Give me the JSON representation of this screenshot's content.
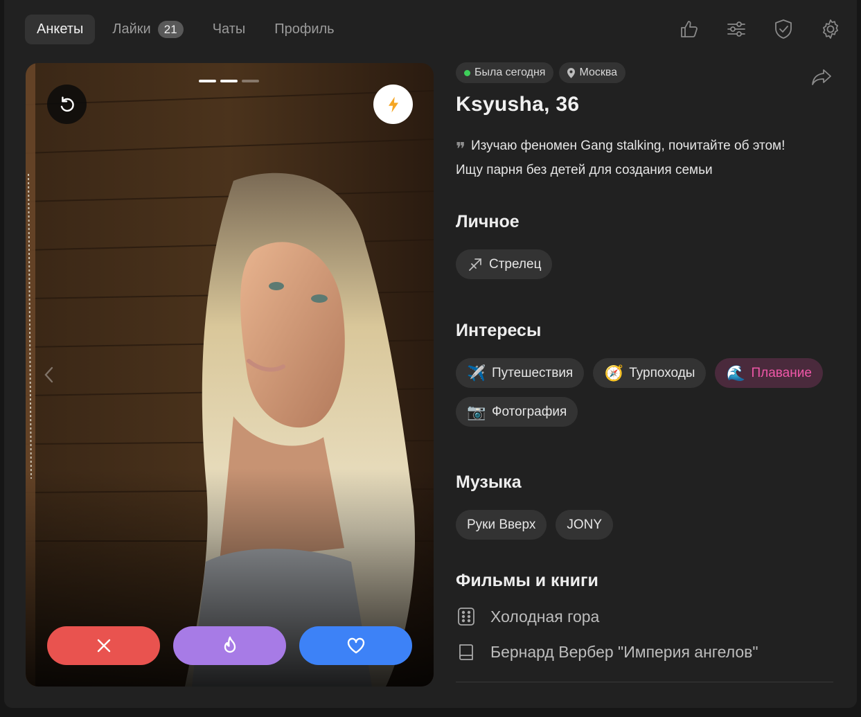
{
  "nav": {
    "tabs": [
      {
        "label": "Анкеты",
        "active": true
      },
      {
        "label": "Лайки",
        "badge": "21"
      },
      {
        "label": "Чаты"
      },
      {
        "label": "Профиль"
      }
    ],
    "icons": [
      "thumbs-up-icon",
      "filters-icon",
      "shield-check-icon",
      "gear-icon"
    ]
  },
  "card": {
    "photo_count": 3,
    "current_photo": 2,
    "undo_icon": "undo-icon",
    "boost_icon": "lightning-icon",
    "boost_color": "#f5a623",
    "actions": [
      {
        "name": "dislike",
        "icon": "close-icon",
        "color": "#e9534f"
      },
      {
        "name": "super-like",
        "icon": "fire-icon",
        "color": "#a77be6"
      },
      {
        "name": "like",
        "icon": "heart-icon",
        "color": "#3d82f7"
      }
    ]
  },
  "profile": {
    "status": "Была сегодня",
    "status_color": "#3ecf5a",
    "city": "Москва",
    "name_age": "Ksyusha, 36",
    "bio_line1": "Изучаю феномен Gang stalking, почитайте об этом!",
    "bio_line2": "Ищу парня без детей для создания семьи",
    "sections": {
      "personal": {
        "title": "Личное",
        "items": [
          {
            "icon": "sagittarius-icon",
            "label": "Стрелец"
          }
        ]
      },
      "interests": {
        "title": "Интересы",
        "items": [
          {
            "emoji": "✈️",
            "label": "Путешествия"
          },
          {
            "emoji": "🧭",
            "label": "Турпоходы"
          },
          {
            "emoji": "🌊",
            "label": "Плавание",
            "highlighted": true
          },
          {
            "emoji": "📷",
            "label": "Фотография"
          }
        ]
      },
      "music": {
        "title": "Музыка",
        "items": [
          {
            "label": "Руки Вверх"
          },
          {
            "label": "JONY"
          }
        ]
      },
      "media": {
        "title": "Фильмы и книги",
        "items": [
          {
            "icon": "film-icon",
            "label": "Холодная гора"
          },
          {
            "icon": "book-icon",
            "label": "Бернард Вербер \"Империя ангелов\""
          }
        ]
      }
    }
  }
}
